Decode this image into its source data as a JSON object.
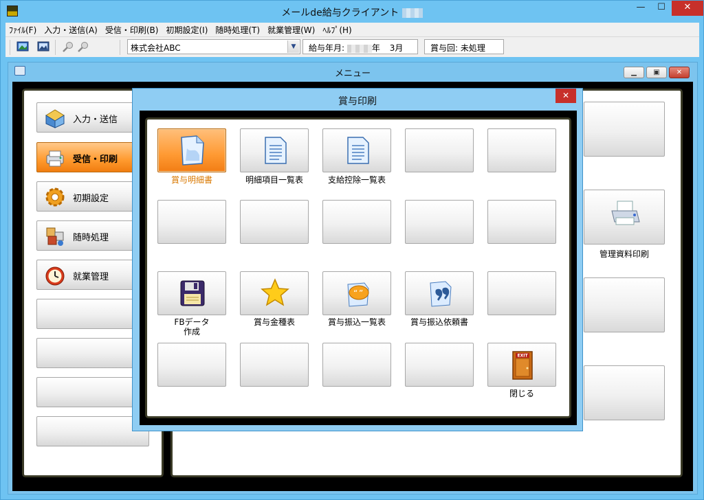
{
  "app": {
    "title": "メールde給与クライアント",
    "window_controls": {
      "minimize": "—",
      "maximize": "☐",
      "close": "✕"
    }
  },
  "menubar": [
    "ﾌｧｲﾙ(F)",
    "入力・送信(A)",
    "受信・印刷(B)",
    "初期設定(I)",
    "随時処理(T)",
    "就業管理(W)",
    "ﾍﾙﾌﾟ(H)"
  ],
  "toolbar": {
    "company": "株式会社ABC",
    "pay_month_label": "給与年月:",
    "pay_month_year_suffix": "年",
    "pay_month_value": "3月",
    "bonus_label": "賞与回: 未処理"
  },
  "menu_window": {
    "title": "メニュー",
    "sidebar": [
      {
        "label": "入力・送信",
        "icon": "input-send-icon",
        "active": false
      },
      {
        "label": "受信・印刷",
        "icon": "receive-print-icon",
        "active": true
      },
      {
        "label": "初期設定",
        "icon": "settings-gear-icon",
        "active": false
      },
      {
        "label": "随時処理",
        "icon": "process-boxes-icon",
        "active": false
      },
      {
        "label": "就業管理",
        "icon": "alarm-clock-icon",
        "active": false
      }
    ],
    "right_panel": {
      "print_management_label": "管理資料印刷"
    }
  },
  "dialog": {
    "title": "賞与印刷",
    "close": "✕",
    "buttons": [
      {
        "label": "賞与明細書",
        "icon": "document-icon",
        "active": true
      },
      {
        "label": "明細項目一覧表",
        "icon": "document-list-icon",
        "active": false
      },
      {
        "label": "支給控除一覧表",
        "icon": "document-list-icon",
        "active": false
      },
      {
        "label": "FBデータ\n作成",
        "icon": "floppy-disk-icon",
        "active": false
      },
      {
        "label": "賞与金種表",
        "icon": "star-icon",
        "active": false
      },
      {
        "label": "賞与振込一覧表",
        "icon": "quote-bubble-icon",
        "active": false
      },
      {
        "label": "賞与振込依頼書",
        "icon": "quote-document-icon",
        "active": false
      },
      {
        "label": "閉じる",
        "icon": "exit-door-icon",
        "active": false
      }
    ],
    "exit_sign": "EXIT"
  },
  "colors": {
    "window_frame": "#6ec3f2",
    "active_orange": "#ff9a2e",
    "active_label": "#d97800",
    "panel_border": "#3a3a26"
  }
}
